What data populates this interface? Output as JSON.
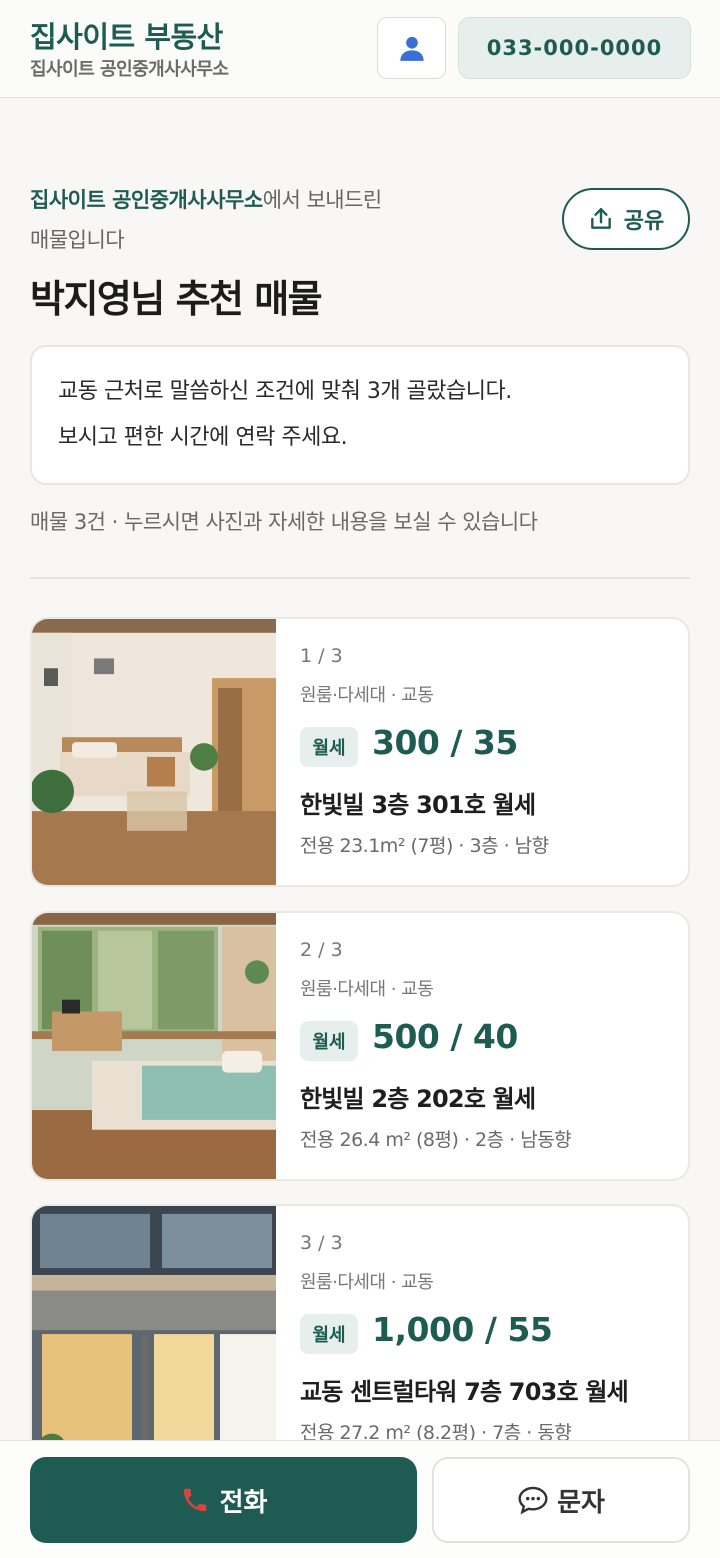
{
  "header": {
    "brand_title": "집사이트 부동산",
    "brand_subtitle": "집사이트 공인중개사사무소",
    "user_icon": "user-icon",
    "phone": "033-000-0000"
  },
  "intro": {
    "office": "집사이트 공인중개사사무소",
    "text_after_office": "에서 보내드린",
    "text_line2": "매물입니다",
    "share_label": "공유",
    "share_icon": "share-icon"
  },
  "title": "박지영님 추천 매물",
  "message": {
    "line1": "교동 근처로 말씀하신 조건에 맞춰 3개 골랐습니다.",
    "line2": "보시고 편한 시간에 연락 주세요."
  },
  "count_line": "매물 3건 · 누르시면 사진과 자세한 내용을 보실 수 있습니다",
  "listings": [
    {
      "index": "1 / 3",
      "type": "원룸·다세대 · 교동",
      "deal": "월세",
      "price": "300 / 35",
      "name": "한빛빌 3층 301호 월세",
      "spec": "전용 23.1m² (7평) · 3층 · 남향",
      "image": "studio-room-photo"
    },
    {
      "index": "2 / 3",
      "type": "원룸·다세대 · 교동",
      "deal": "월세",
      "price": "500 / 40",
      "name": "한빛빌 2층 202호 월세",
      "spec": "전용 26.4 m² (8평) · 2층 · 남동향",
      "image": "bright-studio-photo"
    },
    {
      "index": "3 / 3",
      "type": "원룸·다세대 · 교동",
      "deal": "월세",
      "price": "1,000 / 55",
      "name": "교동 센트럴타워 7층 703호 월세",
      "spec": "전용 27.2 m² (8.2평) · 7층 · 동향",
      "image": "building-exterior-photo"
    }
  ],
  "actions": {
    "call_label": "전화",
    "call_icon": "phone-icon",
    "sms_label": "문자",
    "sms_icon": "chat-bubble-icon"
  },
  "colors": {
    "brand": "#1e5b52",
    "brand_light": "#e7efec",
    "background": "#f8f7f5"
  }
}
